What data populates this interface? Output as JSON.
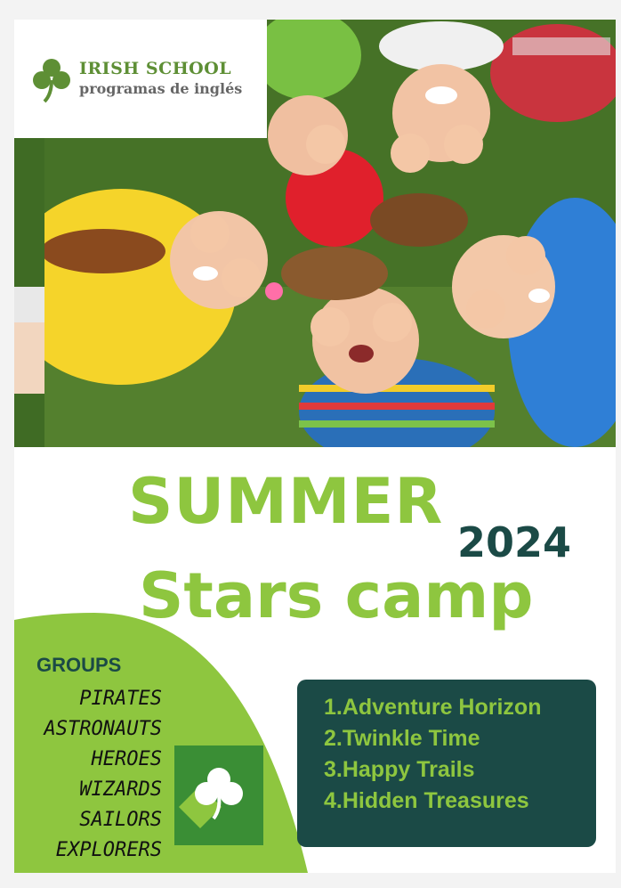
{
  "logo": {
    "line1": "IRISH SCHOOL",
    "line2": "programas de inglés",
    "icon": "shamrock-icon",
    "color": "#5e8f35"
  },
  "photo": {
    "description_icon": "children-photo"
  },
  "title": {
    "line1": "SUMMER",
    "year": "2024",
    "line2": "Stars camp",
    "accent_color": "#8ec63f",
    "year_color": "#1b4a46"
  },
  "groups": {
    "heading": "GROUPS",
    "items": [
      "PIRATES",
      "ASTRONAUTS",
      "HEROES",
      "WIZARDS",
      "SAILORS",
      "EXPLORERS"
    ]
  },
  "camps": {
    "items": [
      "1.Adventure Horizon",
      "2.Twinkle Time",
      "3.Happy Trails",
      "4.Hidden Treasures"
    ],
    "panel_color": "#1b4a46"
  }
}
